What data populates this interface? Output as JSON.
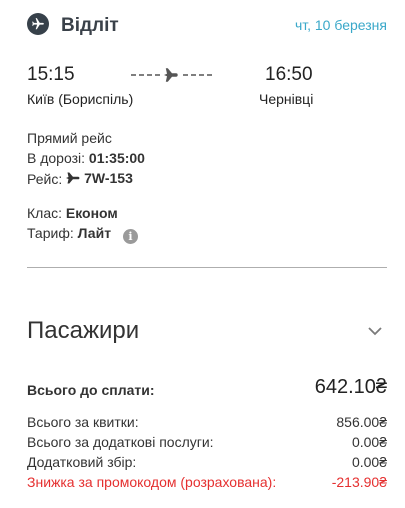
{
  "header": {
    "title": "Відліт",
    "date": "чт, 10 березня",
    "icon": "plane-icon"
  },
  "route": {
    "departure_time": "15:15",
    "departure_city": "Київ (Бориспіль)",
    "arrival_time": "16:50",
    "arrival_city": "Чернівці"
  },
  "details": {
    "direct_label": "Прямий рейс",
    "duration_label": "В дорозі:",
    "duration_value": "01:35:00",
    "flight_label": "Рейс:",
    "flight_value": "7W-153",
    "class_label": "Клас:",
    "class_value": "Економ",
    "fare_label": "Тариф:",
    "fare_value": "Лайт",
    "info_icon_text": "i"
  },
  "passengers": {
    "title": "Пасажири"
  },
  "summary": {
    "total_label": "Всього до сплати:",
    "total_value": "642.10₴",
    "lines": [
      {
        "label": "Всього за квитки:",
        "value": "856.00₴"
      },
      {
        "label": "Всього за додаткові послуги:",
        "value": "0.00₴"
      },
      {
        "label": "Додатковий збір:",
        "value": "0.00₴"
      },
      {
        "label": "Знижка за промокодом (розрахована):",
        "value": "-213.90₴"
      }
    ]
  },
  "colors": {
    "accent": "#3aa8c9",
    "dark_icon": "#37414a",
    "discount": "#e53030"
  }
}
